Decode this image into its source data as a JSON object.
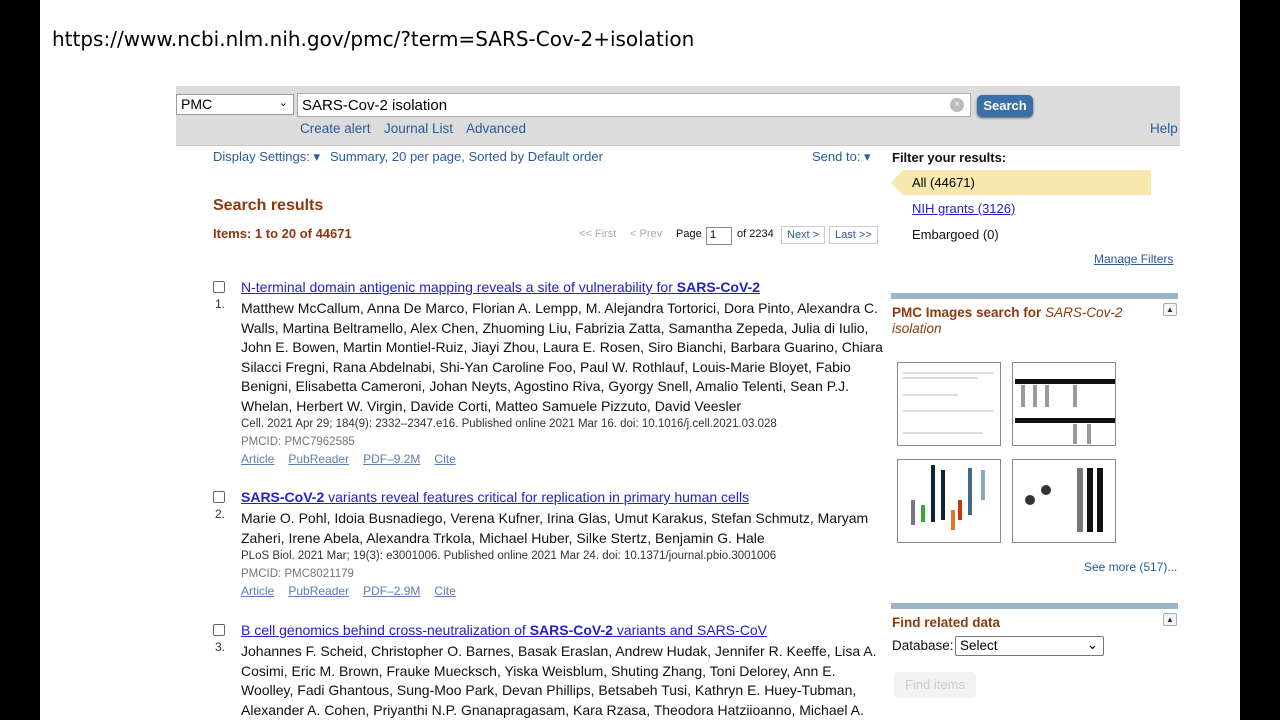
{
  "url": "https://www.ncbi.nlm.nih.gov/pmc/?term=SARS-Cov-2+isolation",
  "search": {
    "database": "PMC",
    "query": "SARS-Cov-2 isolation",
    "button": "Search",
    "links": [
      "Create alert",
      "Journal List",
      "Advanced"
    ],
    "help": "Help"
  },
  "display": {
    "label": "Display Settings:",
    "value": "Summary, 20 per page, Sorted by Default order",
    "send_to": "Send to:"
  },
  "results": {
    "heading": "Search results",
    "items": "Items: 1 to 20 of 44671",
    "pager": {
      "first": "<< First",
      "prev": "< Prev",
      "page_label": "Page",
      "page": "1",
      "of": "of 2234",
      "next": "Next >",
      "last": "Last >>"
    },
    "list": [
      {
        "num": "1.",
        "title_before": "N-terminal domain antigenic mapping reveals a site of vulnerability for ",
        "title_bold": "SARS-CoV-2",
        "title_after": "",
        "authors": "Matthew McCallum, Anna De Marco, Florian A. Lempp, M. Alejandra Tortorici, Dora Pinto, Alexandra C. Walls, Martina Beltramello, Alex Chen, Zhuoming Liu, Fabrizia Zatta, Samantha Zepeda, Julia di Iulio, John E. Bowen, Martin Montiel-Ruiz, Jiayi Zhou, Laura E. Rosen, Siro Bianchi, Barbara Guarino, Chiara Silacci Fregni, Rana Abdelnabi, Shi-Yan Caroline Foo, Paul W. Rothlauf, Louis-Marie Bloyet, Fabio Benigni, Elisabetta Cameroni, Johan Neyts, Agostino Riva, Gyorgy Snell, Amalio Telenti, Sean P.J. Whelan, Herbert W. Virgin, Davide Corti, Matteo Samuele Pizzuto, David Veesler",
        "citation": "Cell. 2021 Apr 29; 184(9): 2332–2347.e16. Published online 2021 Mar 16. doi: 10.1016/j.cell.2021.03.028",
        "pmcid": "PMCID: PMC7962585",
        "links": [
          "Article",
          "PubReader",
          "PDF–9.2M",
          "Cite"
        ]
      },
      {
        "num": "2.",
        "title_before": "",
        "title_bold": "SARS-CoV-2",
        "title_after": " variants reveal features critical for replication in primary human cells",
        "authors": "Marie O. Pohl, Idoia Busnadiego, Verena Kufner, Irina Glas, Umut Karakus, Stefan Schmutz, Maryam Zaheri, Irene Abela, Alexandra Trkola, Michael Huber, Silke Stertz, Benjamin G. Hale",
        "citation": "PLoS Biol. 2021 Mar; 19(3): e3001006. Published online 2021 Mar 24. doi: 10.1371/journal.pbio.3001006",
        "pmcid": "PMCID: PMC8021179",
        "links": [
          "Article",
          "PubReader",
          "PDF–2.9M",
          "Cite"
        ]
      },
      {
        "num": "3.",
        "title_before": "B cell genomics behind cross-neutralization of ",
        "title_bold": "SARS-CoV-2",
        "title_after": " variants and SARS-CoV",
        "authors": "Johannes F. Scheid, Christopher O. Barnes, Basak Eraslan, Andrew Hudak, Jennifer R. Keeffe, Lisa A. Cosimi, Eric M. Brown, Frauke Muecksch, Yiska Weisblum, Shuting Zhang, Toni Delorey, Ann E. Woolley, Fadi Ghantous, Sung-Moo Park, Devan Phillips, Betsabeh Tusi, Kathryn E. Huey-Tubman, Alexander A. Cohen, Priyanthi N.P. Gnanapragasam, Kara Rzasa, Theodora Hatziioanno, Michael A."
      }
    ]
  },
  "sidebar": {
    "filter_title": "Filter your results:",
    "filters": [
      "All (44671)",
      "NIH grants (3126)",
      "Embargoed (0)"
    ],
    "manage": "Manage Filters",
    "images_title": "PMC Images search for ",
    "images_query": "SARS-Cov-2 isolation",
    "see_more": "See more (517)...",
    "related_title": "Find related data",
    "database_label": "Database:",
    "database_value": "Select",
    "find_button": "Find items"
  },
  "colors": {
    "accent_heading": "#8b3a0f",
    "link": "#2222cc",
    "search_button": "#3a6fa8",
    "active_filter": "#f8e8b0"
  }
}
